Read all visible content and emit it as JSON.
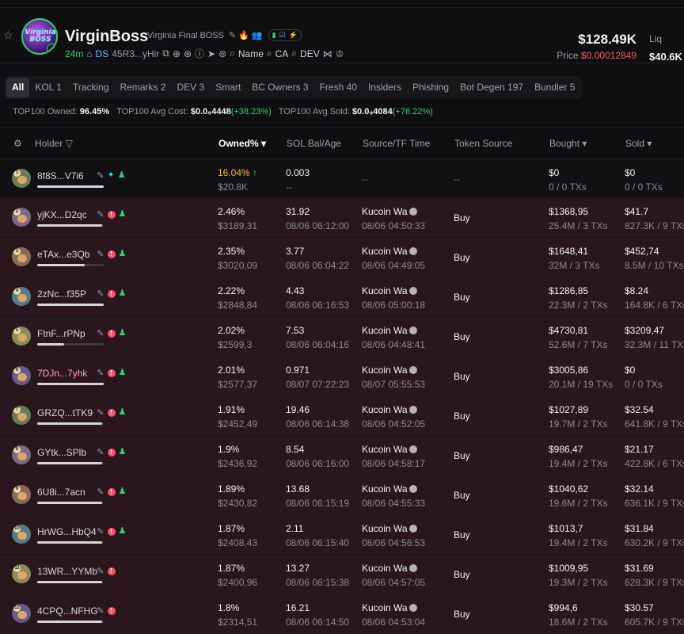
{
  "token": {
    "name": "VirginBoss",
    "full_name": "Virginia Final BOSS",
    "logo_text": "Virginia BOSS",
    "age": "24m",
    "ds_label": "DS",
    "ca_short": "45R3...yHir",
    "links": {
      "name": "Name",
      "ca": "CA",
      "dev": "DEV"
    },
    "market_cap": "$128.49K",
    "price_label": "Price",
    "price": "$0.00012849",
    "liq_label": "Liq",
    "liq": "$40.6K"
  },
  "tabs": [
    {
      "label": "All",
      "active": true
    },
    {
      "label": "KOL 1"
    },
    {
      "label": "Tracking"
    },
    {
      "label": "Remarks 2"
    },
    {
      "label": "DEV 3"
    },
    {
      "label": "Smart"
    },
    {
      "label": "BC Owners 3"
    },
    {
      "label": "Fresh 40"
    },
    {
      "label": "Insiders"
    },
    {
      "label": "Phishing"
    },
    {
      "label": "Bot Degen 197"
    },
    {
      "label": "Bundler 5"
    }
  ],
  "summary": {
    "owned_label": "TOP100 Owned:",
    "owned": "96.45%",
    "avg_cost_label": "TOP100 Avg Cost:",
    "avg_cost": "$0.0₉4448",
    "avg_cost_change": "(+38.23%)",
    "avg_sold_label": "TOP100 Avg Sold:",
    "avg_sold": "$0.0₉4084",
    "avg_sold_change": "(+76.22%)"
  },
  "columns": {
    "holder": "Holder",
    "owned": "Owned% ▾",
    "sol_bal": "SOL Bal/Age",
    "source": "Source/TF Time",
    "token_source": "Token Source",
    "bought": "Bought ▾",
    "sold": "Sold ▾"
  },
  "rows": [
    {
      "rank": "1",
      "addr": "8f8S...V7i6",
      "owned": "16.04%",
      "owned_val": "$20.8K",
      "sol": "0.003",
      "sol_age": "--",
      "source": "--",
      "token_source": "--",
      "bought": "$0",
      "bought_sub": "0 / 0 TXs",
      "sold": "$0",
      "sold_sub": "0 / 0 TXs",
      "bar": 1.0
    },
    {
      "rank": "2",
      "addr": "yjKX...D2qc",
      "owned": "2.46%",
      "owned_val": "$3189,31",
      "sol": "31.92",
      "sol_age": "08/06 06:12:00",
      "source": "Kucoin Wa",
      "source_time": "08/06 04:50:33",
      "token_source": "Buy",
      "bought": "$1368,95",
      "bought_sub": "25.4M / 3 TXs",
      "sold": "$41.7",
      "sold_sub": "827.3K / 9 TXs",
      "bar": 0.98
    },
    {
      "rank": "3",
      "addr": "eTAx...e3Qb",
      "owned": "2.35%",
      "owned_val": "$3020,09",
      "sol": "3.77",
      "sol_age": "08/06 06:04:22",
      "source": "Kucoin Wa",
      "source_time": "08/06 04:49:05",
      "token_source": "Buy",
      "bought": "$1648,41",
      "bought_sub": "32M / 3 TXs",
      "sold": "$452,74",
      "sold_sub": "8.5M / 10 TXs",
      "bar": 0.72
    },
    {
      "rank": "4",
      "addr": "2zNc...f35P",
      "owned": "2.22%",
      "owned_val": "$2848,84",
      "sol": "4.43",
      "sol_age": "08/06 06:16:53",
      "source": "Kucoin Wa",
      "source_time": "08/06 05:00:18",
      "token_source": "Buy",
      "bought": "$1286,85",
      "bought_sub": "22.3M / 2 TXs",
      "sold": "$8.24",
      "sold_sub": "164.8K / 6 TXs",
      "bar": 1.0
    },
    {
      "rank": "5",
      "addr": "FtnF...rPNp",
      "owned": "2.02%",
      "owned_val": "$2599,3",
      "sol": "7.53",
      "sol_age": "08/06 06:04:16",
      "source": "Kucoin Wa",
      "source_time": "08/06 04:48:41",
      "token_source": "Buy",
      "bought": "$4730,81",
      "bought_sub": "52.6M / 7 TXs",
      "sold": "$3209,47",
      "sold_sub": "32.3M / 11 TXs",
      "bar": 0.4
    },
    {
      "rank": "6",
      "addr": "7DJn...7yhk",
      "owned": "2.01%",
      "owned_val": "$2577,37",
      "sol": "0.971",
      "sol_age": "08/07 07:22:23",
      "source": "Kucoin Wa",
      "source_time": "08/07 05:55:53",
      "token_source": "Buy",
      "bought": "$3005,86",
      "bought_sub": "20.1M / 19 TXs",
      "sold": "$0",
      "sold_sub": "0 / 0 TXs",
      "bar": 1.0,
      "pink": true
    },
    {
      "rank": "7",
      "addr": "GRZQ...tTK9",
      "owned": "1.91%",
      "owned_val": "$2452,49",
      "sol": "19.46",
      "sol_age": "08/06 06:14:38",
      "source": "Kucoin Wa",
      "source_time": "08/06 04:52:05",
      "token_source": "Buy",
      "bought": "$1027,89",
      "bought_sub": "19.7M / 2 TXs",
      "sold": "$32.54",
      "sold_sub": "641.8K / 9 TXs",
      "bar": 0.98
    },
    {
      "rank": "8",
      "addr": "GYtk...SPlb",
      "owned": "1.9%",
      "owned_val": "$2436,92",
      "sol": "8.54",
      "sol_age": "08/06 06:16:00",
      "source": "Kucoin Wa",
      "source_time": "08/06 04:58:17",
      "token_source": "Buy",
      "bought": "$986,47",
      "bought_sub": "19.4M / 2 TXs",
      "sold": "$21.17",
      "sold_sub": "422.8K / 6 TXs",
      "bar": 0.98
    },
    {
      "rank": "9",
      "addr": "6U8i...7acn",
      "owned": "1.89%",
      "owned_val": "$2430,82",
      "sol": "13.68",
      "sol_age": "08/06 06:15:19",
      "source": "Kucoin Wa",
      "source_time": "08/06 04:55:33",
      "token_source": "Buy",
      "bought": "$1040,62",
      "bought_sub": "19.6M / 2 TXs",
      "sold": "$32.14",
      "sold_sub": "636.1K / 9 TXs",
      "bar": 0.98
    },
    {
      "rank": "10",
      "addr": "HrWG...HbQ4",
      "owned": "1.87%",
      "owned_val": "$2408,43",
      "sol": "2.11",
      "sol_age": "08/06 06:15:40",
      "source": "Kucoin Wa",
      "source_time": "08/06 04:56:53",
      "token_source": "Buy",
      "bought": "$1013,7",
      "bought_sub": "19.4M / 2 TXs",
      "sold": "$31.84",
      "sold_sub": "630.2K / 9 TXs",
      "bar": 0.98
    },
    {
      "rank": "11",
      "addr": "13WR...YYMb",
      "owned": "1.87%",
      "owned_val": "$2400,96",
      "sol": "13.27",
      "sol_age": "08/06 06:15:38",
      "source": "Kucoin Wa",
      "source_time": "08/06 04:57:05",
      "token_source": "Buy",
      "bought": "$1009,95",
      "bought_sub": "19.3M / 2 TXs",
      "sold": "$31.69",
      "sold_sub": "628.3K / 9 TXs",
      "bar": 0.98,
      "no_user": true
    },
    {
      "rank": "12",
      "addr": "4CPQ...NFHG",
      "owned": "1.8%",
      "owned_val": "$2314,51",
      "sol": "16.21",
      "sol_age": "08/06 06:14:50",
      "source": "Kucoin Wa",
      "source_time": "08/06 04:53:04",
      "token_source": "Buy",
      "bought": "$994,6",
      "bought_sub": "18.6M / 2 TXs",
      "sold": "$30.57",
      "sold_sub": "605.7K / 9 TXs",
      "bar": 0.98,
      "no_user": true
    }
  ]
}
